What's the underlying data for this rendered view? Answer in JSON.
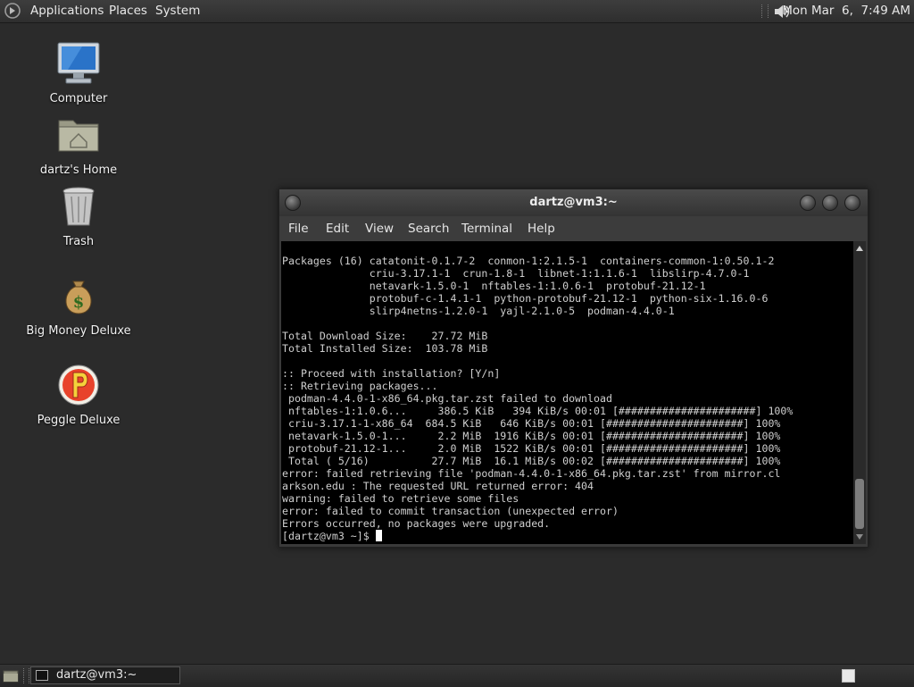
{
  "top_panel": {
    "menus": [
      "Applications",
      "Places",
      "System"
    ],
    "clock": "Mon Mar  6,  7:49 AM",
    "icons": [
      "gnome-foot-icon",
      "volume-icon"
    ]
  },
  "desktop": {
    "icons": [
      {
        "label": "Computer",
        "icon": "computer-icon"
      },
      {
        "label": "dartz's Home",
        "icon": "home-folder-icon"
      },
      {
        "label": "Trash",
        "icon": "trash-icon"
      },
      {
        "label": "Big Money Deluxe",
        "icon": "money-bag-icon"
      },
      {
        "label": "Peggle Deluxe",
        "icon": "peggle-icon"
      }
    ]
  },
  "terminal": {
    "title": "dartz@vm3:~",
    "menu": [
      "File",
      "Edit",
      "View",
      "Search",
      "Terminal",
      "Help"
    ],
    "output": "Packages (16) catatonit-0.1.7-2  conmon-1:2.1.5-1  containers-common-1:0.50.1-2\n              criu-3.17.1-1  crun-1.8-1  libnet-1:1.1.6-1  libslirp-4.7.0-1\n              netavark-1.5.0-1  nftables-1:1.0.6-1  protobuf-21.12-1\n              protobuf-c-1.4.1-1  python-protobuf-21.12-1  python-six-1.16.0-6\n              slirp4netns-1.2.0-1  yajl-2.1.0-5  podman-4.4.0-1\n\nTotal Download Size:    27.72 MiB\nTotal Installed Size:  103.78 MiB\n\n:: Proceed with installation? [Y/n]\n:: Retrieving packages...\n podman-4.4.0-1-x86_64.pkg.tar.zst failed to download\n nftables-1:1.0.6...     386.5 KiB   394 KiB/s 00:01 [######################] 100%\n criu-3.17.1-1-x86_64  684.5 KiB   646 KiB/s 00:01 [######################] 100%\n netavark-1.5.0-1...     2.2 MiB  1916 KiB/s 00:01 [######################] 100%\n protobuf-21.12-1...     2.0 MiB  1522 KiB/s 00:01 [######################] 100%\n Total ( 5/16)          27.7 MiB  16.1 MiB/s 00:02 [######################] 100%\nerror: failed retrieving file 'podman-4.4.0-1-x86_64.pkg.tar.zst' from mirror.cl\narkson.edu : The requested URL returned error: 404\nwarning: failed to retrieve some files\nerror: failed to commit transaction (unexpected error)\nErrors occurred, no packages were upgraded.\n[dartz@vm3 ~]$ ",
    "scrollbar_position": 0.92
  },
  "bottom_panel": {
    "task_button_label": "dartz@vm3:~",
    "workspace": "workspace-switcher-icon"
  }
}
